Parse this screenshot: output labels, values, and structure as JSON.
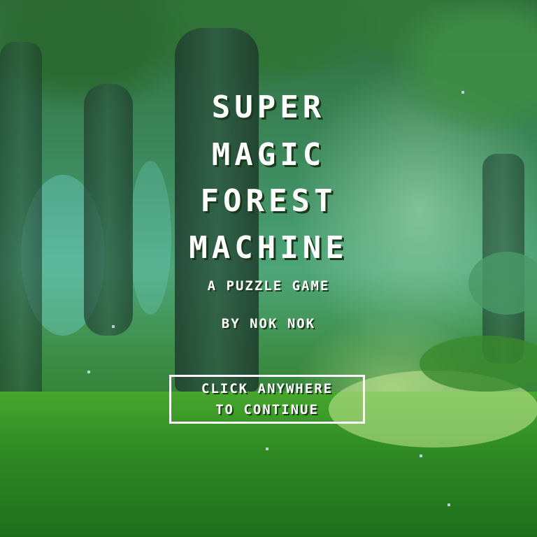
{
  "title": {
    "lines": [
      "SUPER",
      "MAGIC",
      "FOREST",
      "MACHINE"
    ]
  },
  "subtitle": "A PUZZLE GAME",
  "credit": "BY NOK NOK",
  "continue_prompt": {
    "line1": "CLICK ANYWHERE",
    "line2": "TO CONTINUE"
  },
  "colors": {
    "text": "#ffffff",
    "grass": "#2f8a24",
    "foliage": "#3f8f63"
  }
}
